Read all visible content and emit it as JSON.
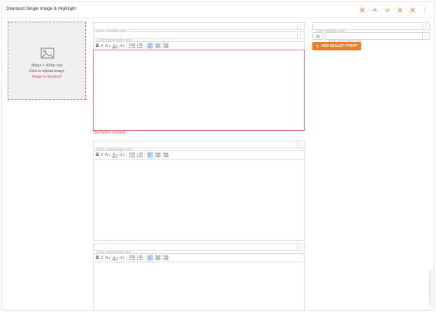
{
  "header": {
    "title": "Standard Single Image & Highlight",
    "buttons": [
      {
        "name": "remove-block-icon",
        "label": "×"
      },
      {
        "name": "move-up-icon",
        "label": "^"
      },
      {
        "name": "move-down-icon",
        "label": "v"
      },
      {
        "name": "collapse-icon",
        "label": "×"
      },
      {
        "name": "close-icon",
        "label": "×"
      },
      {
        "name": "more-options-icon",
        "label": "⋮"
      }
    ],
    "accent": "#f07c2a"
  },
  "image_upload": {
    "size_text": "300px × 300px min",
    "upload_text": "Click to upload image",
    "error_text": "Image is required!",
    "icon": "image-icon"
  },
  "main": {
    "headline_placeholder": "Enter headline text",
    "sections": [
      {
        "subheadline_placeholder": "Enter subheadline text",
        "error": "This field is required."
      },
      {
        "subheadline_placeholder": "Enter subheadline text"
      },
      {
        "subheadline_placeholder": "Enter subheadline text"
      }
    ],
    "toolbar": {
      "bold": "B",
      "italic": "I",
      "font_size": "A",
      "font_color": "A",
      "highlight": "A"
    }
  },
  "sidebar": {
    "headline_placeholder": "Enter headline text",
    "bullet_placeholder": "Enter bullet point text",
    "add_bullet_label": "ADD BULLET POINT",
    "add_bullet_icon": "+"
  },
  "colors": {
    "accent": "#f07c2a",
    "error": "#e0464e",
    "active_align": "#e3ecfb"
  }
}
